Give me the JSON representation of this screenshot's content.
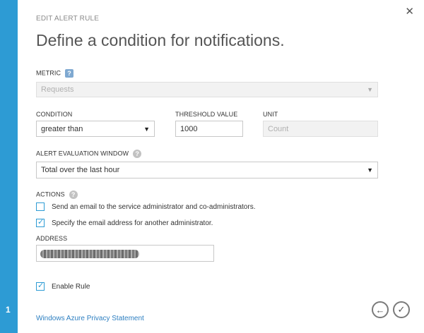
{
  "wizard": {
    "step": "1"
  },
  "header": {
    "eyebrow": "EDIT ALERT RULE",
    "title": "Define a condition for notifications."
  },
  "metric": {
    "label": "METRIC",
    "value": "Requests"
  },
  "condition": {
    "label": "CONDITION",
    "value": "greater than"
  },
  "threshold": {
    "label": "THRESHOLD VALUE",
    "value": "1000"
  },
  "unit": {
    "label": "UNIT",
    "value": "Count"
  },
  "window": {
    "label": "ALERT EVALUATION WINDOW",
    "value": "Total over the last hour"
  },
  "actions": {
    "label": "ACTIONS",
    "email_admins": {
      "label": "Send an email to the service administrator and co-administrators.",
      "checked": false
    },
    "email_other": {
      "label": "Specify the email address for another administrator.",
      "checked": true
    }
  },
  "address": {
    "label": "ADDRESS"
  },
  "enable_rule": {
    "label": "Enable Rule",
    "checked": true
  },
  "footer": {
    "privacy_link": "Windows Azure Privacy Statement"
  },
  "icons": {
    "help": "?",
    "close": "✕",
    "caret": "▼",
    "back": "←",
    "confirm": "✓"
  },
  "colors": {
    "accent": "#2d9bd4",
    "link": "#2d7fc1"
  }
}
